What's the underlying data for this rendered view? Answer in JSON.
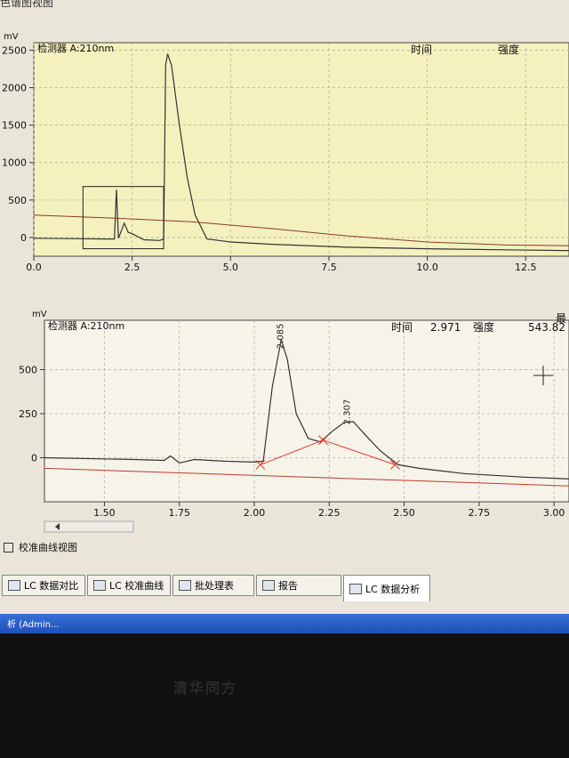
{
  "window": {
    "title": "色谱图视图"
  },
  "chart_data": [
    {
      "type": "line",
      "detector_label": "检测器 A:210nm",
      "ylabel": "mV",
      "header_time": "时间",
      "header_intensity": "强度",
      "xlim": [
        0.0,
        13.6
      ],
      "ylim": [
        -250,
        2600
      ],
      "x_ticks": [
        "0.0",
        "2.5",
        "5.0",
        "7.5",
        "10.0",
        "12.5"
      ],
      "x_tick_values": [
        0.0,
        2.5,
        5.0,
        7.5,
        10.0,
        12.5
      ],
      "y_ticks": [
        "2500",
        "2000",
        "1500",
        "1000",
        "500",
        "0"
      ],
      "y_tick_values": [
        2500,
        2000,
        1500,
        1000,
        500,
        0
      ],
      "series": [
        {
          "color": "#333333",
          "x": [
            0.0,
            1.0,
            1.8,
            2.05,
            2.1,
            2.15,
            2.3,
            2.4,
            2.5,
            2.8,
            3.2,
            3.3,
            3.35,
            3.4,
            3.5,
            3.7,
            3.9,
            4.1,
            4.4,
            5.0,
            6.0,
            8.0,
            10.0,
            12.0,
            13.6
          ],
          "y": [
            -10,
            -15,
            -20,
            -20,
            640,
            -10,
            190,
            70,
            50,
            -30,
            -40,
            -20,
            2300,
            2450,
            2300,
            1500,
            800,
            300,
            -20,
            -60,
            -90,
            -130,
            -150,
            -165,
            -175
          ]
        },
        {
          "color": "#8a3a2a",
          "x": [
            0.0,
            2.0,
            4.0,
            6.0,
            8.0,
            10.0,
            12.0,
            13.6
          ],
          "y": [
            300,
            260,
            210,
            120,
            20,
            -60,
            -100,
            -110
          ]
        }
      ],
      "zoom_box": {
        "x": [
          1.25,
          3.3
        ],
        "y": [
          -150,
          680
        ]
      }
    },
    {
      "type": "line",
      "detector_label": "检测器 A:210nm",
      "ylabel": "mV",
      "header_time": "时间",
      "header_time_value": "2.971",
      "header_intensity": "强度",
      "header_intensity_value": "543.82",
      "header_max": "最",
      "xlim": [
        1.3,
        3.05
      ],
      "ylim": [
        -250,
        780
      ],
      "x_ticks": [
        "1.50",
        "1.75",
        "2.00",
        "2.25",
        "2.50",
        "2.75",
        "3.00"
      ],
      "x_tick_values": [
        1.5,
        1.75,
        2.0,
        2.25,
        2.5,
        2.75,
        3.0
      ],
      "y_ticks": [
        "500",
        "250",
        "0"
      ],
      "y_tick_values": [
        500,
        250,
        0
      ],
      "peak_labels": [
        {
          "x": 2.085,
          "y": 690,
          "text": "2.085"
        },
        {
          "x": 2.307,
          "y": 260,
          "text": "2.307"
        }
      ],
      "series": [
        {
          "color": "#333333",
          "x": [
            1.3,
            1.6,
            1.7,
            1.72,
            1.75,
            1.8,
            1.9,
            2.0,
            2.03,
            2.06,
            2.09,
            2.11,
            2.14,
            2.18,
            2.22,
            2.26,
            2.3,
            2.33,
            2.37,
            2.42,
            2.48,
            2.55,
            2.7,
            2.9,
            3.05
          ],
          "y": [
            0,
            -10,
            -15,
            10,
            -30,
            -10,
            -20,
            -25,
            -20,
            400,
            670,
            560,
            250,
            110,
            90,
            150,
            200,
            205,
            130,
            40,
            -40,
            -60,
            -90,
            -110,
            -120
          ]
        },
        {
          "color": "#c0392b",
          "x": [
            1.3,
            3.05
          ],
          "y": [
            -60,
            -160
          ]
        }
      ],
      "baseline_segments": [
        {
          "x": [
            2.02,
            2.23
          ],
          "y": [
            -40,
            100
          ]
        },
        {
          "x": [
            2.23,
            2.47
          ],
          "y": [
            100,
            -40
          ]
        }
      ]
    }
  ],
  "panels": {
    "calibration_view": "校准曲线视图"
  },
  "tabs": [
    {
      "label": "LC 数据对比"
    },
    {
      "label": "LC 校准曲线"
    },
    {
      "label": "批处理表"
    },
    {
      "label": "报告"
    },
    {
      "label": "LC 数据分析"
    }
  ],
  "taskbar": {
    "item": "析 (Admin..."
  },
  "bezel": {
    "brand": "清华同方"
  }
}
